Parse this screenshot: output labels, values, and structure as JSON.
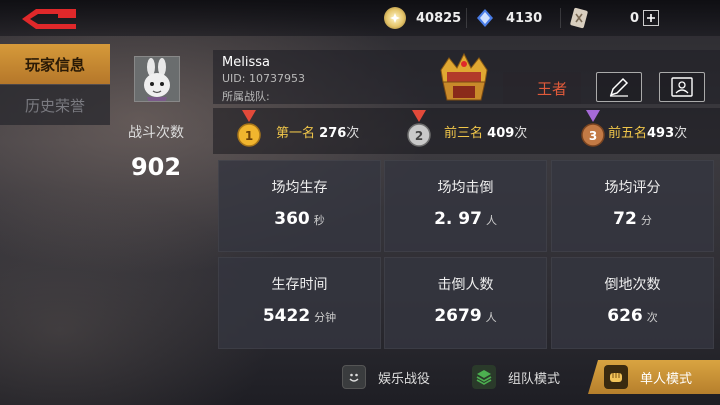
{
  "currencies": [
    {
      "icon": "gold-coin-icon",
      "value": "40825"
    },
    {
      "icon": "diamond-icon",
      "value": "4130"
    },
    {
      "icon": "card-ticket-icon",
      "value": "0"
    }
  ],
  "tabs": {
    "player_info": "玩家信息",
    "history_honor": "历史荣誉"
  },
  "player": {
    "name": "Melissa",
    "uid": "UID: 10737953",
    "team": "所属战队:",
    "rank": "王者"
  },
  "battles": {
    "label": "战斗次数",
    "value": "902"
  },
  "medals": [
    {
      "label": "第一名",
      "count": "276",
      "unit": "次",
      "color": "#f1b52e"
    },
    {
      "label": "前三名",
      "count": "409",
      "unit": "次",
      "color": "#b9b9b9"
    },
    {
      "label": "前五名",
      "count": "493",
      "unit": "次",
      "color": "#c37a45"
    }
  ],
  "stats": [
    {
      "label": "场均生存",
      "value": "360",
      "unit": "秒"
    },
    {
      "label": "场均击倒",
      "value": "2. 97",
      "unit": "人"
    },
    {
      "label": "场均评分",
      "value": "72",
      "unit": "分"
    },
    {
      "label": "生存时间",
      "value": "5422",
      "unit": "分钟"
    },
    {
      "label": "击倒人数",
      "value": "2679",
      "unit": "人"
    },
    {
      "label": "倒地次数",
      "value": "626",
      "unit": "次"
    }
  ],
  "modes": {
    "casual": "娱乐战役",
    "squad": "组队模式",
    "solo": "单人模式"
  },
  "colors": {
    "accent": "#d69a3a",
    "rank": "#e05a3a",
    "medal_label": "#f0c64a"
  }
}
